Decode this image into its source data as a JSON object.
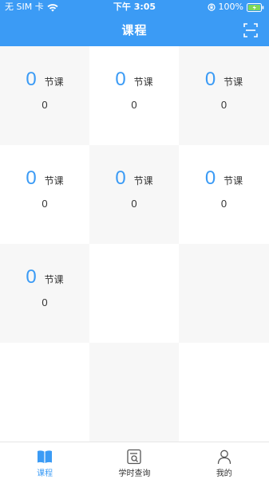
{
  "status_bar": {
    "carrier": "无 SIM 卡",
    "time": "下午 3:05",
    "battery": "100%"
  },
  "nav": {
    "title": "课程",
    "scan_icon": "scan-icon"
  },
  "courses": [
    {
      "count": "0",
      "unit": "节课",
      "sub": "0"
    },
    {
      "count": "0",
      "unit": "节课",
      "sub": "0"
    },
    {
      "count": "0",
      "unit": "节课",
      "sub": "0"
    },
    {
      "count": "0",
      "unit": "节课",
      "sub": "0"
    },
    {
      "count": "0",
      "unit": "节课",
      "sub": "0"
    },
    {
      "count": "0",
      "unit": "节课",
      "sub": "0"
    },
    {
      "count": "0",
      "unit": "节课",
      "sub": "0"
    }
  ],
  "tabs": [
    {
      "label": "课程",
      "icon": "book-icon",
      "active": true
    },
    {
      "label": "学时查询",
      "icon": "search-document-icon",
      "active": false
    },
    {
      "label": "我的",
      "icon": "person-icon",
      "active": false
    }
  ],
  "colors": {
    "accent": "#3b9bf5",
    "cell_shade": "#f7f7f7",
    "text": "#333333"
  }
}
